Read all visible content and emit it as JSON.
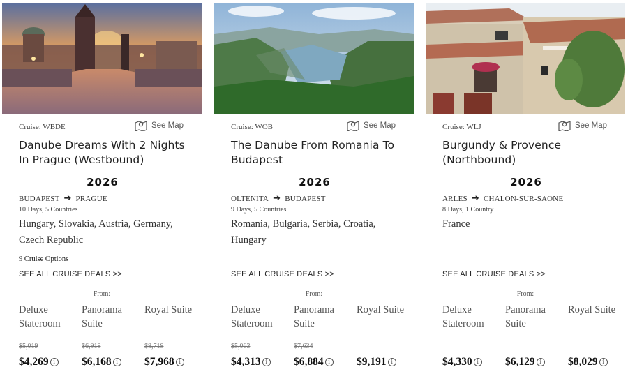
{
  "labels": {
    "see_map": "See Map",
    "see_all_deals": "SEE ALL CRUISE DEALS >>",
    "from": "From:"
  },
  "icons": {
    "map": "map-pin-icon",
    "info": "info-icon",
    "arrow": "arrow-right-icon"
  },
  "cruises": [
    {
      "code": "Cruise: WBDE",
      "title": "Danube Dreams With 2 Nights In Prague (Westbound)",
      "year": "2026",
      "route_from": "BUDAPEST",
      "route_to": "PRAGUE",
      "duration": "10 Days, 5 Countries",
      "countries": "Hungary, Slovakia, Austria, Germany, Czech Republic",
      "options": "9 Cruise Options",
      "prices": [
        {
          "category": "Deluxe Stateroom",
          "original": "$5,019",
          "price": "$4,269"
        },
        {
          "category": "Panorama Suite",
          "original": "$6,918",
          "price": "$6,168"
        },
        {
          "category": "Royal Suite",
          "original": "$8,718",
          "price": "$7,968"
        }
      ]
    },
    {
      "code": "Cruise: WOB",
      "title": "The Danube From Romania To Budapest",
      "year": "2026",
      "route_from": "OLTENITA",
      "route_to": "BUDAPEST",
      "duration": "9 Days, 5 Countries",
      "countries": "Romania, Bulgaria, Serbia, Croatia, Hungary",
      "options": "",
      "prices": [
        {
          "category": "Deluxe Stateroom",
          "original": "$5,063",
          "price": "$4,313"
        },
        {
          "category": "Panorama Suite",
          "original": "$7,634",
          "price": "$6,884"
        },
        {
          "category": "Royal Suite",
          "original": "",
          "price": "$9,191"
        }
      ]
    },
    {
      "code": "Cruise: WLJ",
      "title": "Burgundy & Provence (Northbound)",
      "year": "2026",
      "route_from": "ARLES",
      "route_to": "CHALON-SUR-SAONE",
      "duration": "8 Days, 1 Country",
      "countries": "France",
      "options": "",
      "prices": [
        {
          "category": "Deluxe Stateroom",
          "original": "",
          "price": "$4,330"
        },
        {
          "category": "Panorama Suite",
          "original": "",
          "price": "$6,129"
        },
        {
          "category": "Royal Suite",
          "original": "",
          "price": "$8,029"
        }
      ]
    }
  ]
}
